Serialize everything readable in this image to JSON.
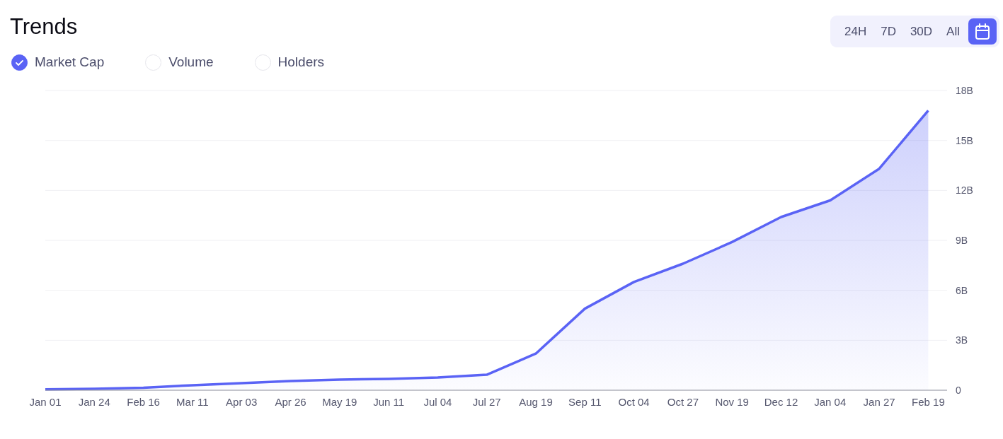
{
  "title": "Trends",
  "metrics": [
    {
      "label": "Market Cap",
      "selected": true
    },
    {
      "label": "Volume",
      "selected": false
    },
    {
      "label": "Holders",
      "selected": false
    }
  ],
  "ranges": [
    {
      "label": "24H",
      "selected": false
    },
    {
      "label": "7D",
      "selected": false
    },
    {
      "label": "30D",
      "selected": false
    },
    {
      "label": "All",
      "selected": false
    }
  ],
  "calendar": {
    "selected": true
  },
  "chart_data": {
    "type": "area",
    "categories": [
      "Jan 01",
      "Jan 24",
      "Feb 16",
      "Mar 11",
      "Apr 03",
      "Apr 26",
      "May 19",
      "Jun 11",
      "Jul 04",
      "Jul 27",
      "Aug 19",
      "Sep 11",
      "Oct 04",
      "Oct 27",
      "Nov 19",
      "Dec 12",
      "Jan 04",
      "Jan 27",
      "Feb 19"
    ],
    "grid": true,
    "series": [
      {
        "color": "#5a63f5",
        "values": [
          0.05,
          0.08,
          0.15,
          0.3,
          0.42,
          0.55,
          0.64,
          0.68,
          0.76,
          0.93,
          2.2,
          4.9,
          6.5,
          7.6,
          8.9,
          10.4,
          11.4,
          13.3,
          16.8
        ]
      }
    ],
    "ylim": [
      0,
      18
    ],
    "yticks": [
      {
        "value": 0,
        "label": "0"
      },
      {
        "value": 3,
        "label": "3B"
      },
      {
        "value": 6,
        "label": "6B"
      },
      {
        "value": 9,
        "label": "9B"
      },
      {
        "value": 12,
        "label": "12B"
      },
      {
        "value": 15,
        "label": "15B"
      },
      {
        "value": 18,
        "label": "18B"
      }
    ]
  }
}
